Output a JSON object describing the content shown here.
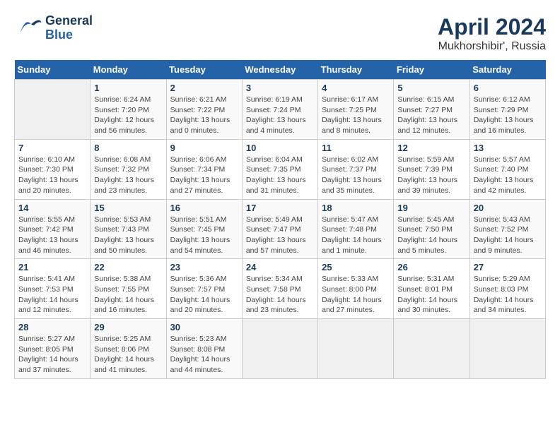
{
  "header": {
    "logo_general": "General",
    "logo_blue": "Blue",
    "title": "April 2024",
    "subtitle": "Mukhorshibir', Russia"
  },
  "days_of_week": [
    "Sunday",
    "Monday",
    "Tuesday",
    "Wednesday",
    "Thursday",
    "Friday",
    "Saturday"
  ],
  "weeks": [
    [
      {
        "num": "",
        "info": ""
      },
      {
        "num": "1",
        "info": "Sunrise: 6:24 AM\nSunset: 7:20 PM\nDaylight: 12 hours\nand 56 minutes."
      },
      {
        "num": "2",
        "info": "Sunrise: 6:21 AM\nSunset: 7:22 PM\nDaylight: 13 hours\nand 0 minutes."
      },
      {
        "num": "3",
        "info": "Sunrise: 6:19 AM\nSunset: 7:24 PM\nDaylight: 13 hours\nand 4 minutes."
      },
      {
        "num": "4",
        "info": "Sunrise: 6:17 AM\nSunset: 7:25 PM\nDaylight: 13 hours\nand 8 minutes."
      },
      {
        "num": "5",
        "info": "Sunrise: 6:15 AM\nSunset: 7:27 PM\nDaylight: 13 hours\nand 12 minutes."
      },
      {
        "num": "6",
        "info": "Sunrise: 6:12 AM\nSunset: 7:29 PM\nDaylight: 13 hours\nand 16 minutes."
      }
    ],
    [
      {
        "num": "7",
        "info": "Sunrise: 6:10 AM\nSunset: 7:30 PM\nDaylight: 13 hours\nand 20 minutes."
      },
      {
        "num": "8",
        "info": "Sunrise: 6:08 AM\nSunset: 7:32 PM\nDaylight: 13 hours\nand 23 minutes."
      },
      {
        "num": "9",
        "info": "Sunrise: 6:06 AM\nSunset: 7:34 PM\nDaylight: 13 hours\nand 27 minutes."
      },
      {
        "num": "10",
        "info": "Sunrise: 6:04 AM\nSunset: 7:35 PM\nDaylight: 13 hours\nand 31 minutes."
      },
      {
        "num": "11",
        "info": "Sunrise: 6:02 AM\nSunset: 7:37 PM\nDaylight: 13 hours\nand 35 minutes."
      },
      {
        "num": "12",
        "info": "Sunrise: 5:59 AM\nSunset: 7:39 PM\nDaylight: 13 hours\nand 39 minutes."
      },
      {
        "num": "13",
        "info": "Sunrise: 5:57 AM\nSunset: 7:40 PM\nDaylight: 13 hours\nand 42 minutes."
      }
    ],
    [
      {
        "num": "14",
        "info": "Sunrise: 5:55 AM\nSunset: 7:42 PM\nDaylight: 13 hours\nand 46 minutes."
      },
      {
        "num": "15",
        "info": "Sunrise: 5:53 AM\nSunset: 7:43 PM\nDaylight: 13 hours\nand 50 minutes."
      },
      {
        "num": "16",
        "info": "Sunrise: 5:51 AM\nSunset: 7:45 PM\nDaylight: 13 hours\nand 54 minutes."
      },
      {
        "num": "17",
        "info": "Sunrise: 5:49 AM\nSunset: 7:47 PM\nDaylight: 13 hours\nand 57 minutes."
      },
      {
        "num": "18",
        "info": "Sunrise: 5:47 AM\nSunset: 7:48 PM\nDaylight: 14 hours\nand 1 minute."
      },
      {
        "num": "19",
        "info": "Sunrise: 5:45 AM\nSunset: 7:50 PM\nDaylight: 14 hours\nand 5 minutes."
      },
      {
        "num": "20",
        "info": "Sunrise: 5:43 AM\nSunset: 7:52 PM\nDaylight: 14 hours\nand 9 minutes."
      }
    ],
    [
      {
        "num": "21",
        "info": "Sunrise: 5:41 AM\nSunset: 7:53 PM\nDaylight: 14 hours\nand 12 minutes."
      },
      {
        "num": "22",
        "info": "Sunrise: 5:38 AM\nSunset: 7:55 PM\nDaylight: 14 hours\nand 16 minutes."
      },
      {
        "num": "23",
        "info": "Sunrise: 5:36 AM\nSunset: 7:57 PM\nDaylight: 14 hours\nand 20 minutes."
      },
      {
        "num": "24",
        "info": "Sunrise: 5:34 AM\nSunset: 7:58 PM\nDaylight: 14 hours\nand 23 minutes."
      },
      {
        "num": "25",
        "info": "Sunrise: 5:33 AM\nSunset: 8:00 PM\nDaylight: 14 hours\nand 27 minutes."
      },
      {
        "num": "26",
        "info": "Sunrise: 5:31 AM\nSunset: 8:01 PM\nDaylight: 14 hours\nand 30 minutes."
      },
      {
        "num": "27",
        "info": "Sunrise: 5:29 AM\nSunset: 8:03 PM\nDaylight: 14 hours\nand 34 minutes."
      }
    ],
    [
      {
        "num": "28",
        "info": "Sunrise: 5:27 AM\nSunset: 8:05 PM\nDaylight: 14 hours\nand 37 minutes."
      },
      {
        "num": "29",
        "info": "Sunrise: 5:25 AM\nSunset: 8:06 PM\nDaylight: 14 hours\nand 41 minutes."
      },
      {
        "num": "30",
        "info": "Sunrise: 5:23 AM\nSunset: 8:08 PM\nDaylight: 14 hours\nand 44 minutes."
      },
      {
        "num": "",
        "info": ""
      },
      {
        "num": "",
        "info": ""
      },
      {
        "num": "",
        "info": ""
      },
      {
        "num": "",
        "info": ""
      }
    ]
  ]
}
